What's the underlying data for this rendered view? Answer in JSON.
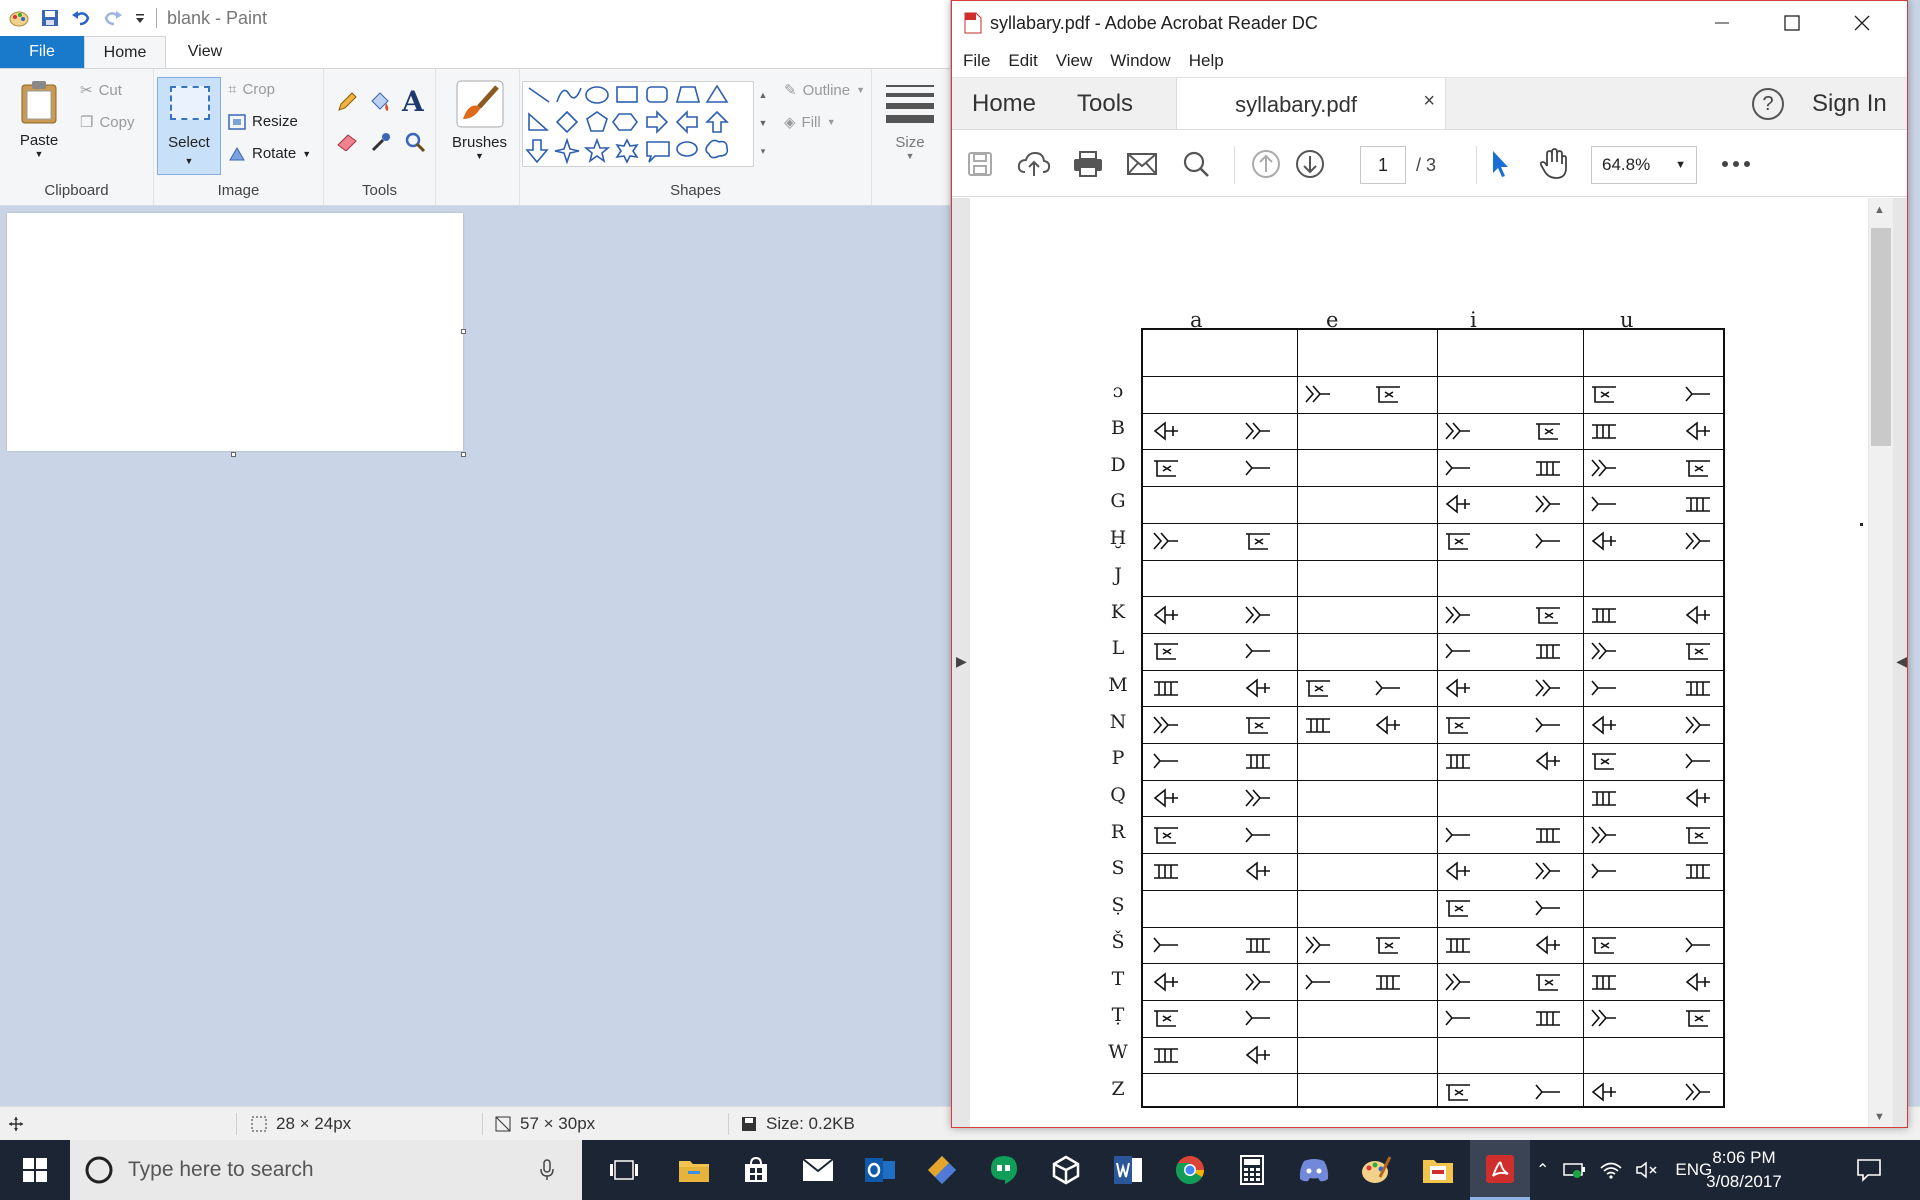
{
  "paint": {
    "title": "blank - Paint",
    "menu": {
      "file": "File",
      "home": "Home",
      "view": "View"
    },
    "ribbon": {
      "clipboard": {
        "paste": "Paste",
        "cut": "Cut",
        "copy": "Copy",
        "label": "Clipboard"
      },
      "image": {
        "select": "Select",
        "crop": "Crop",
        "resize": "Resize",
        "rotate": "Rotate",
        "label": "Image"
      },
      "tools": {
        "label": "Tools"
      },
      "brushes": {
        "label": "Brushes"
      },
      "shapes": {
        "outline": "Outline",
        "fill": "Fill",
        "label": "Shapes"
      },
      "size": {
        "label": "Size"
      }
    },
    "status": {
      "selection": "28 × 24px",
      "canvas": "57 × 30px",
      "size": "Size: 0.2KB"
    }
  },
  "acrobat": {
    "title": "syllabary.pdf - Adobe Acrobat Reader DC",
    "menu": [
      "File",
      "Edit",
      "View",
      "Window",
      "Help"
    ],
    "tabs": {
      "home": "Home",
      "tools": "Tools",
      "doc": "syllabary.pdf",
      "close": "×",
      "signin": "Sign In",
      "help": "?"
    },
    "toolbar": {
      "page": "1",
      "total": "/ 3",
      "zoom": "64.8%"
    },
    "document": {
      "vowels": [
        "a",
        "e",
        "i",
        "u"
      ],
      "rows": [
        "ɔ",
        "B",
        "D",
        "G",
        "Ḫ",
        "J",
        "K",
        "L",
        "M",
        "N",
        "P",
        "Q",
        "R",
        "S",
        "Ṣ",
        "Š",
        "T",
        "Ṭ",
        "W",
        "Z"
      ]
    }
  },
  "taskbar": {
    "search_placeholder": "Type here to search",
    "lang": "ENG",
    "time": "8:06 PM",
    "date": "3/08/2017"
  },
  "colors": {
    "paint_accent": "#1979ca",
    "acrobat_red": "#d83b3b",
    "taskbar": "#1b2533"
  }
}
